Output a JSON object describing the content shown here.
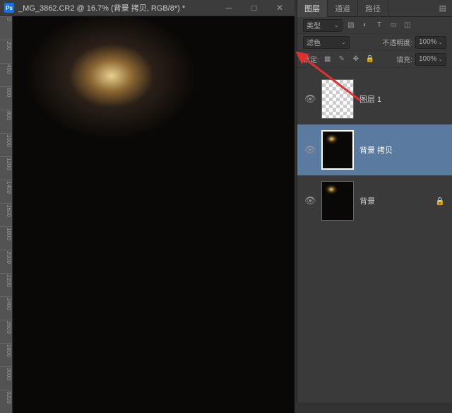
{
  "doc": {
    "title": "_MG_3862.CR2 @ 16.7% (背景 拷贝, RGB/8*) *"
  },
  "ruler_h": [
    "0",
    "200",
    "400",
    "600",
    "800",
    "1000",
    "1200",
    "1400",
    "1600",
    "1800",
    "2000",
    "2200",
    "2400"
  ],
  "ruler_v": [
    "0",
    "200",
    "400",
    "600",
    "800",
    "1000",
    "1200",
    "1400",
    "1600",
    "1800",
    "2000",
    "2200",
    "2400",
    "2600",
    "2800",
    "3000",
    "3200"
  ],
  "tabs": {
    "t1": "图层",
    "t2": "通道",
    "t3": "路径"
  },
  "row1": {
    "kind": "类型"
  },
  "row2": {
    "blend": "滤色",
    "opacity_lbl": "不透明度:",
    "opacity_val": "100%"
  },
  "row3": {
    "lock_lbl": "锁定:",
    "fill_lbl": "填充:",
    "fill_val": "100%"
  },
  "layers": {
    "l1": "图层 1",
    "l2": "背景 拷贝",
    "l3": "背景"
  }
}
